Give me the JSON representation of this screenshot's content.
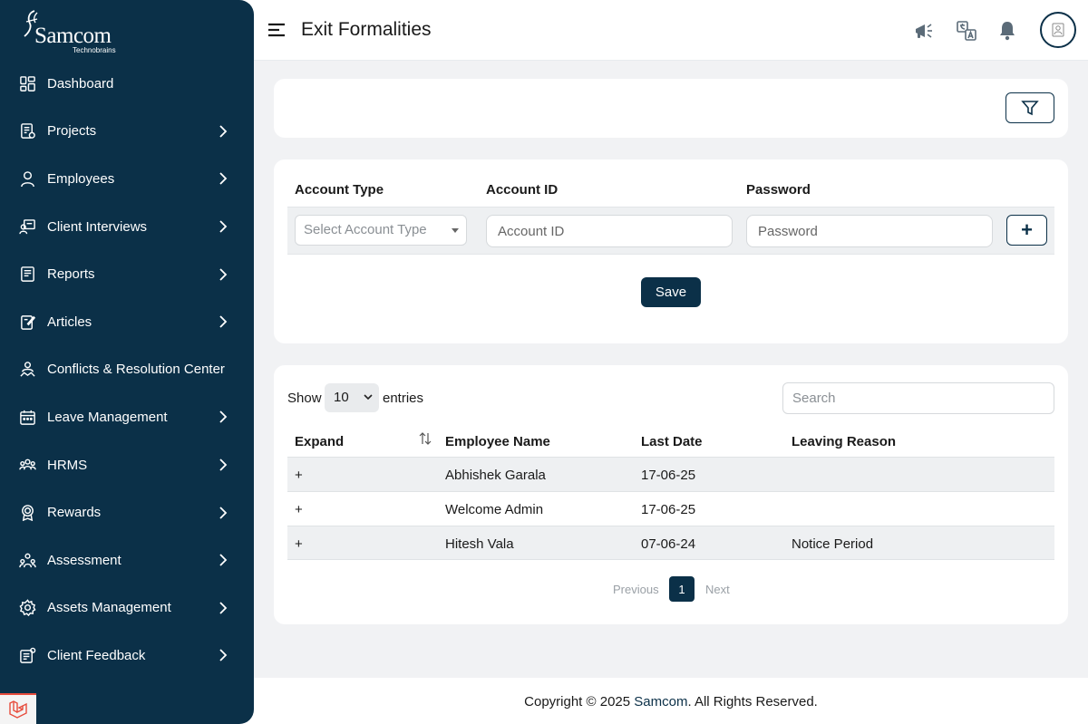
{
  "app": {
    "brand": "Samcom",
    "brand_tagline": "Technobrains",
    "page_title": "Exit Formalities"
  },
  "sidebar": {
    "items": [
      {
        "label": "Dashboard",
        "icon": "dashboard-icon",
        "has_submenu": false
      },
      {
        "label": "Projects",
        "icon": "projects-icon",
        "has_submenu": true
      },
      {
        "label": "Employees",
        "icon": "user-icon",
        "has_submenu": true
      },
      {
        "label": "Client Interviews",
        "icon": "interview-icon",
        "has_submenu": true
      },
      {
        "label": "Reports",
        "icon": "reports-icon",
        "has_submenu": true
      },
      {
        "label": "Articles",
        "icon": "articles-icon",
        "has_submenu": true
      },
      {
        "label": "Conflicts & Resolution Center",
        "icon": "conflict-icon",
        "has_submenu": false
      },
      {
        "label": "Leave Management",
        "icon": "calendar-icon",
        "has_submenu": true
      },
      {
        "label": "HRMS",
        "icon": "hrms-icon",
        "has_submenu": true
      },
      {
        "label": "Rewards",
        "icon": "rewards-icon",
        "has_submenu": true
      },
      {
        "label": "Assessment",
        "icon": "assessment-icon",
        "has_submenu": true
      },
      {
        "label": "Assets Management",
        "icon": "gear-icon",
        "has_submenu": true
      },
      {
        "label": "Client Feedback",
        "icon": "feedback-icon",
        "has_submenu": true
      }
    ]
  },
  "header": {
    "icons": [
      "megaphone-icon",
      "translate-icon",
      "bell-icon",
      "avatar"
    ]
  },
  "form": {
    "account_type_label": "Account Type",
    "account_id_label": "Account ID",
    "password_label": "Password",
    "account_type_placeholder": "Select Account Type",
    "account_id_placeholder": "Account ID",
    "password_placeholder": "Password",
    "add_label": "+",
    "save_label": "Save"
  },
  "table": {
    "show_label": "Show",
    "entries_value": "10",
    "entries_label": "entries",
    "search_placeholder": "Search",
    "columns": [
      "Expand",
      "Employee Name",
      "Last Date",
      "Leaving Reason"
    ],
    "rows": [
      {
        "expand": "+",
        "name": "Abhishek Garala",
        "last_date": "17-06-25",
        "reason": ""
      },
      {
        "expand": "+",
        "name": "Welcome Admin",
        "last_date": "17-06-25",
        "reason": ""
      },
      {
        "expand": "+",
        "name": "Hitesh Vala",
        "last_date": "07-06-24",
        "reason": "Notice Period"
      }
    ],
    "pagination": {
      "previous": "Previous",
      "current": "1",
      "next": "Next"
    }
  },
  "footer": {
    "prefix": "Copyright © 2025 ",
    "brand": "Samcom",
    "suffix": ". All Rights Reserved."
  },
  "colors": {
    "sidebar_bg": "#0b3048",
    "accent": "#0b3048",
    "main_bg": "#f1f2f4"
  }
}
